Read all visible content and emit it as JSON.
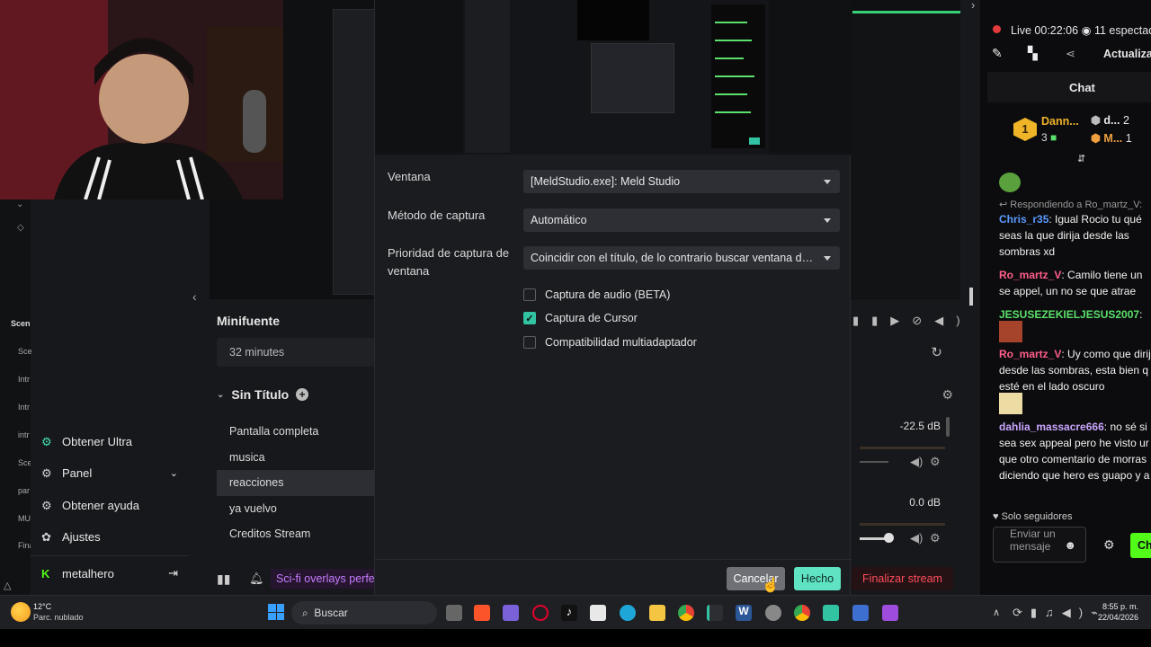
{
  "app": {
    "collapse_arrow": "‹",
    "rail_labels": [
      "Scen",
      "Sce",
      "Intr",
      "Intr",
      "intr",
      "Sce",
      "par",
      "MU",
      "Fina"
    ],
    "menu": {
      "ultra": "Obtener Ultra",
      "panel": "Panel",
      "help": "Obtener ayuda",
      "settings": "Ajustes",
      "user": "metalhero"
    },
    "minifuente": "Minifuente",
    "duration": "32 minutes",
    "scene_title": "Sin Título",
    "scenes": [
      "Pantalla completa",
      "musica",
      "reacciones",
      "ya vuelvo",
      "Creditos Stream"
    ],
    "selected_scene": "reacciones",
    "mixer": {
      "db1": "-22.5 dB",
      "db2": "0.0 dB"
    },
    "ticker": "Sci-fi overlays perfec",
    "end_stream": "Finalizar stream"
  },
  "modal": {
    "fields": [
      {
        "label": "Ventana",
        "value": "[MeldStudio.exe]: Meld Studio"
      },
      {
        "label": "Método de captura",
        "value": "Automático"
      },
      {
        "label": "Prioridad de captura de ventana",
        "value": "Coincidir con el título, de lo contrario buscar ventana del mismo tipo"
      }
    ],
    "checkboxes": [
      {
        "label": "Captura de audio (BETA)",
        "checked": false
      },
      {
        "label": "Captura de Cursor",
        "checked": true
      },
      {
        "label": "Compatibilidad multiadaptador",
        "checked": false
      }
    ],
    "cancel": "Cancelar",
    "done": "Hecho"
  },
  "chat": {
    "live_label": "Live",
    "time": "00:22:06",
    "viewers": "11 espectad",
    "update": "Actualizar",
    "tab": "Chat",
    "leader1_name": "Dann...",
    "leader1_count": "3",
    "leader2_name": "d...",
    "leader2_count": "2",
    "leader3_name": "M...",
    "leader3_count": "1",
    "rank": "1",
    "reply_prefix": "Respondiendo a Ro_martz_V:",
    "messages": [
      {
        "user": "Chris_r35",
        "color": "#5b9bff",
        "text": "Igual Rocio tu qué seas la que dirija desde las sombras xd"
      },
      {
        "user": "Ro_martz_V",
        "color": "#ff5e8a",
        "text": "Camilo tiene un se appel, un no se que atrae"
      },
      {
        "user": "JESUSEZEKIELJESUS2007",
        "color": "#5be06b",
        "text": ""
      },
      {
        "user": "Ro_martz_V",
        "color": "#ff5e8a",
        "text": "Uy como que dirij desde las sombras, esta bien q esté en el lado oscuro"
      },
      {
        "user": "dahlia_massacre666",
        "color": "#c9a6ff",
        "text": "no sé si sea sex appeal pero he visto ur que otro comentario de morras diciendo que hero es guapo y a"
      }
    ],
    "followers_only": "Solo seguidores",
    "input_placeholder": "Enviar un mensaje",
    "send_label": "Ch"
  },
  "taskbar": {
    "temp": "12°C",
    "weather": "Parc. nublado",
    "search": "Buscar",
    "time": "8:55 p. m.",
    "date": "22/04/2026"
  },
  "colors": {
    "accent": "#31c3a2",
    "live": "#e33b3b",
    "chat_green": "#5be06b"
  }
}
